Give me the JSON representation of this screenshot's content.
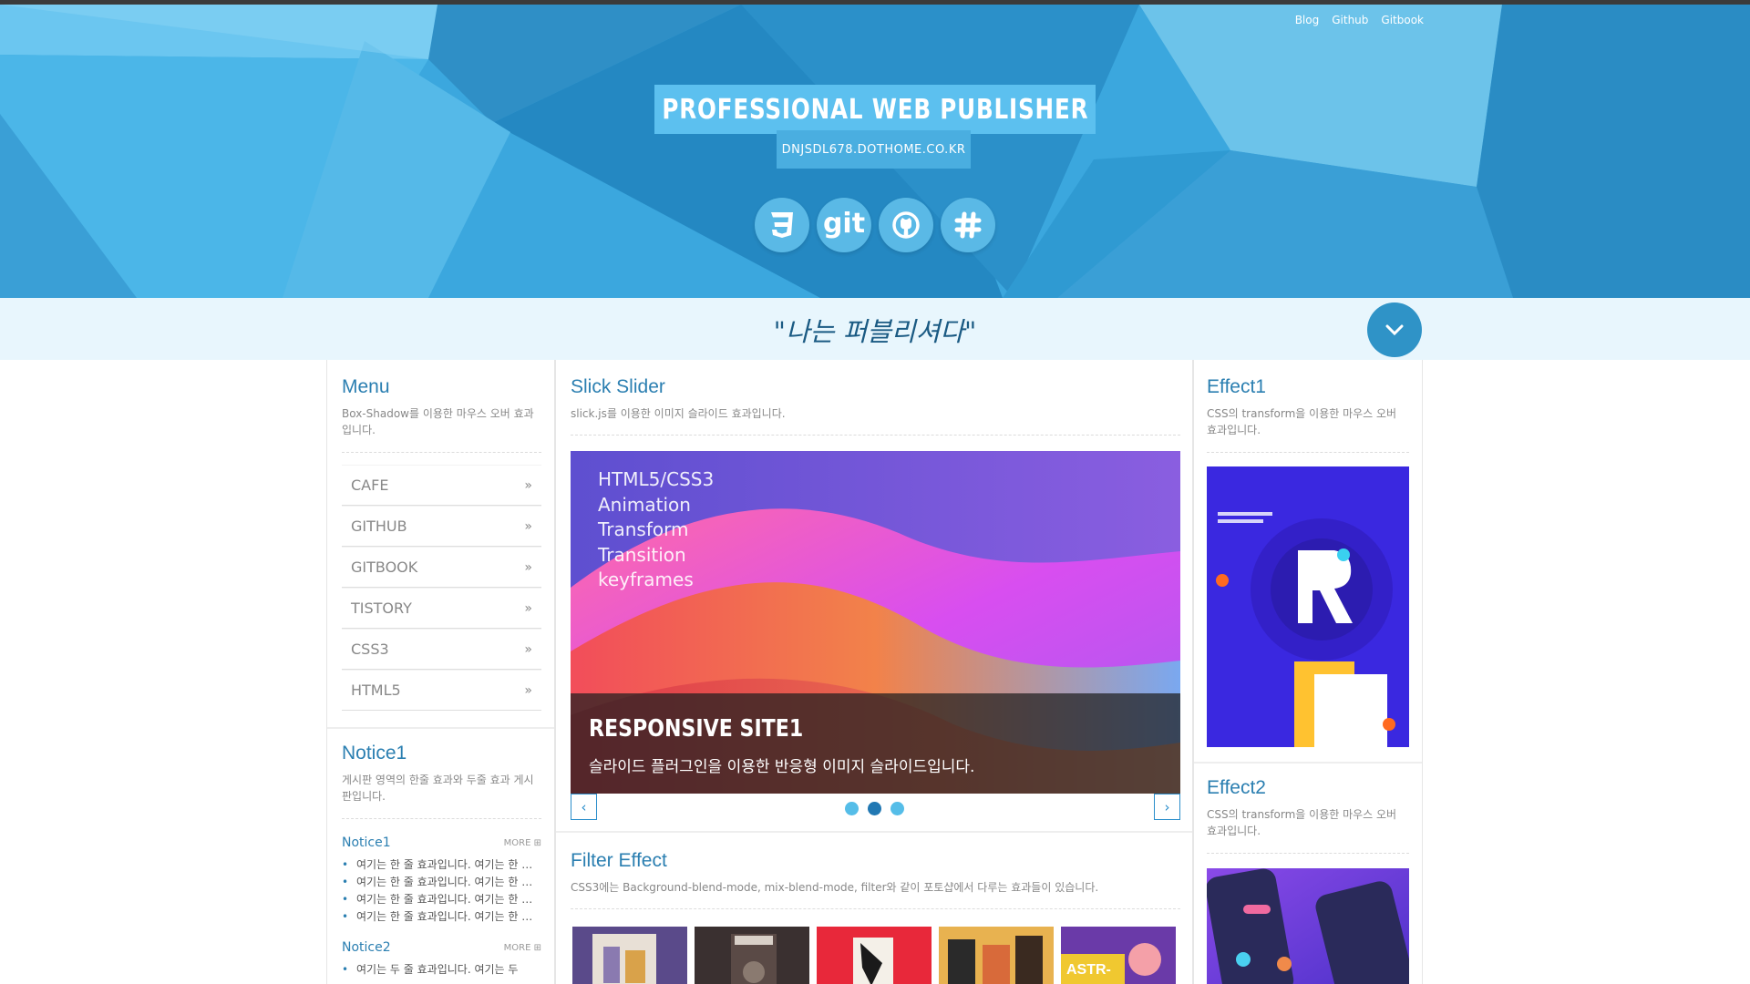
{
  "header": {
    "top_links": [
      "Blog",
      "Github",
      "Gitbook"
    ],
    "title": "PROFESSIONAL WEB PUBLISHER",
    "domain": "DNJSDL678.DOTHOME.CO.KR",
    "social_icons": [
      "css3-icon",
      "git-icon",
      "github-icon",
      "slack-icon"
    ],
    "git_label": "git"
  },
  "slogan": "\"나는 퍼블리셔다\"",
  "menu": {
    "title": "Menu",
    "desc": "Box-Shadow를 이용한 마우스 오버 효과입니다.",
    "items": [
      "CAFE",
      "GITHUB",
      "GITBOOK",
      "TISTORY",
      "CSS3",
      "HTML5"
    ]
  },
  "notice": {
    "title": "Notice1",
    "desc": "게시판 영역의 한줄 효과와 두줄 효과 게시판입니다.",
    "lists": [
      {
        "name": "Notice1",
        "more": "MORE",
        "items": [
          "여기는 한 줄 효과입니다. 여기는 한 줄 효과입니다.",
          "여기는 한 줄 효과입니다. 여기는 한 줄 효과입니다.",
          "여기는 한 줄 효과입니다. 여기는 한 줄 효과입니다.",
          "여기는 한 줄 효과입니다. 여기는 한 줄 효과입니다."
        ]
      },
      {
        "name": "Notice2",
        "more": "MORE",
        "items": [
          "여기는 두 줄 효과입니다. 여기는 두"
        ]
      }
    ]
  },
  "slick": {
    "title": "Slick Slider",
    "desc": "slick.js를 이용한 이미지 슬라이드 효과입니다.",
    "slide_lines": [
      "HTML5/CSS3",
      "Animation",
      "Transform",
      "Transition",
      "keyframes"
    ],
    "slide_title": "RESPONSIVE SITE1",
    "slide_desc": "슬라이드 플러그인을 이용한 반응형 이미지 슬라이드입니다.",
    "prev": "‹",
    "next": "›",
    "dot_count": 3,
    "active_dot": 1
  },
  "filter": {
    "title": "Filter Effect",
    "desc": "CSS3에는 Background-blend-mode, mix-blend-mode, filter와 같이 포토샵에서 다루는 효과들이 있습니다."
  },
  "effect1": {
    "title": "Effect1",
    "desc": "CSS의 transform을 이용한 마우스 오버 효과입니다."
  },
  "effect2": {
    "title": "Effect2",
    "desc": "CSS의 transform을 이용한 마우스 오버 효과입니다."
  }
}
